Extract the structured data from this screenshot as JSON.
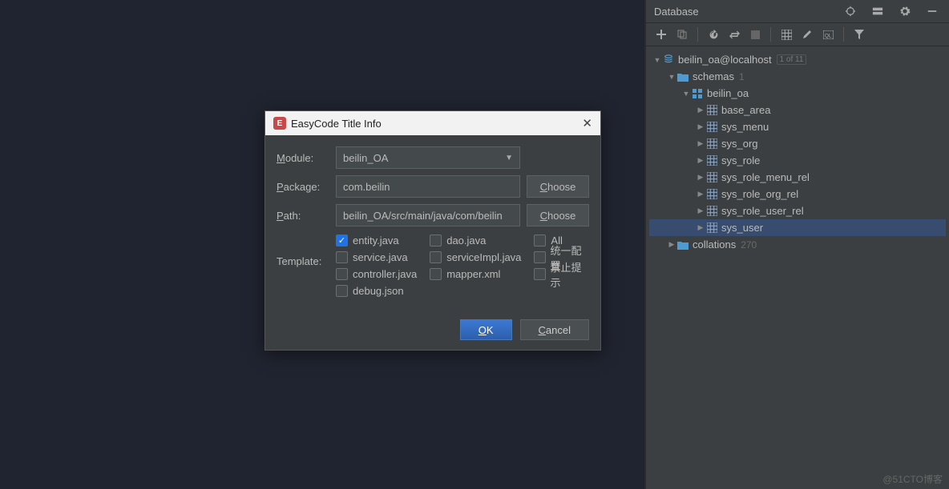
{
  "watermark": "@51CTO博客",
  "db_panel": {
    "title": "Database",
    "tree": {
      "connection": {
        "label": "beilin_oa@localhost",
        "badge": "1 of 11"
      },
      "schemas": {
        "label": "schemas",
        "count": "1"
      },
      "schema": {
        "label": "beilin_oa"
      },
      "tables": [
        "base_area",
        "sys_menu",
        "sys_org",
        "sys_role",
        "sys_role_menu_rel",
        "sys_role_org_rel",
        "sys_role_user_rel",
        "sys_user"
      ],
      "selected_index": 7,
      "collations": {
        "label": "collations",
        "count": "270"
      }
    }
  },
  "dialog": {
    "title": "EasyCode Title Info",
    "labels": {
      "module": "Module:",
      "package": "Package:",
      "path": "Path:",
      "template": "Template:"
    },
    "module_value": "beilin_OA",
    "package_value": "com.beilin",
    "path_value": "beilin_OA/src/main/java/com/beilin",
    "choose": "Choose",
    "templates_col1": [
      {
        "label": "entity.java",
        "checked": true
      },
      {
        "label": "service.java",
        "checked": false
      },
      {
        "label": "controller.java",
        "checked": false
      },
      {
        "label": "debug.json",
        "checked": false
      }
    ],
    "templates_col2": [
      {
        "label": "dao.java",
        "checked": false
      },
      {
        "label": "serviceImpl.java",
        "checked": false
      },
      {
        "label": "mapper.xml",
        "checked": false
      }
    ],
    "options": [
      {
        "label": "All",
        "checked": false
      },
      {
        "label": "统一配置",
        "checked": false
      },
      {
        "label": "禁止提示",
        "checked": false
      }
    ],
    "ok": "OK",
    "cancel": "Cancel"
  }
}
